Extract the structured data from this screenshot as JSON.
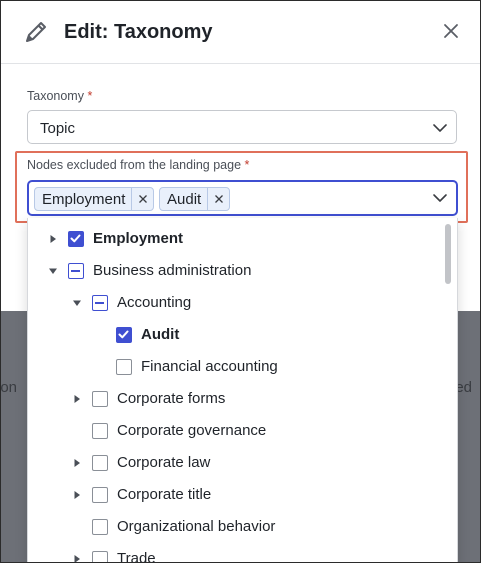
{
  "dialog": {
    "title": "Edit: Taxonomy",
    "icon": "pencil-icon",
    "close_icon": "close-icon"
  },
  "taxonomy_field": {
    "label": "Taxonomy",
    "required_mark": "*",
    "value": "Topic"
  },
  "excluded_field": {
    "label": "Nodes excluded from the landing page",
    "required_mark": "*",
    "chips": [
      "Employment",
      "Audit"
    ]
  },
  "backdrop": {
    "left_text": "ion",
    "right_text": "eed"
  },
  "tree": [
    {
      "label": "Employment",
      "state": "checked",
      "bold": true,
      "expander": "collapsed",
      "level": 0
    },
    {
      "label": "Business administration",
      "state": "indeterminate",
      "bold": false,
      "expander": "expanded",
      "level": 0
    },
    {
      "label": "Accounting",
      "state": "indeterminate",
      "bold": false,
      "expander": "expanded",
      "level": 1
    },
    {
      "label": "Audit",
      "state": "checked",
      "bold": true,
      "expander": "none",
      "level": 2
    },
    {
      "label": "Financial accounting",
      "state": "unchecked",
      "bold": false,
      "expander": "none",
      "level": 2
    },
    {
      "label": "Corporate forms",
      "state": "unchecked",
      "bold": false,
      "expander": "collapsed",
      "level": 1
    },
    {
      "label": "Corporate governance",
      "state": "unchecked",
      "bold": false,
      "expander": "none",
      "level": 1
    },
    {
      "label": "Corporate law",
      "state": "unchecked",
      "bold": false,
      "expander": "collapsed",
      "level": 1
    },
    {
      "label": "Corporate title",
      "state": "unchecked",
      "bold": false,
      "expander": "collapsed",
      "level": 1
    },
    {
      "label": "Organizational behavior",
      "state": "unchecked",
      "bold": false,
      "expander": "none",
      "level": 1
    },
    {
      "label": "Trade",
      "state": "unchecked",
      "bold": false,
      "expander": "collapsed",
      "level": 1
    }
  ],
  "colors": {
    "accent": "#3f4fd1",
    "required": "#c0392b",
    "highlight_border": "#e0705a",
    "chip_bg": "#e9f0fb"
  }
}
